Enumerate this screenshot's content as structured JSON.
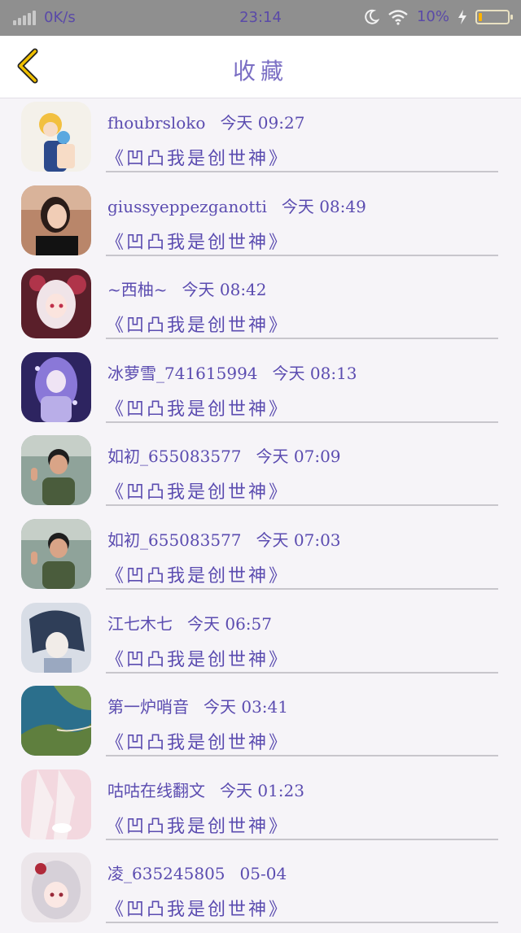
{
  "status_bar": {
    "network_speed": "0K/s",
    "time": "23:14",
    "battery_percent": "10%",
    "battery_level": 0.1,
    "icons": [
      "signal-icon",
      "moon-icon",
      "wifi-icon",
      "charging-icon",
      "battery-icon"
    ]
  },
  "header": {
    "title": "收藏",
    "back_icon": "chevron-left-icon",
    "accent": "#f0c000"
  },
  "items": [
    {
      "user": "fhoubrsloko",
      "time": "今天 09:27",
      "work": "《凹凸我是创世神》"
    },
    {
      "user": "giussyeppezganotti",
      "time": "今天 08:49",
      "work": "《凹凸我是创世神》"
    },
    {
      "user": "~西柚~",
      "time": "今天 08:42",
      "work": "《凹凸我是创世神》"
    },
    {
      "user": "冰萝雪_741615994",
      "time": "今天 08:13",
      "work": "《凹凸我是创世神》"
    },
    {
      "user": "如初_655083577",
      "time": "今天 07:09",
      "work": "《凹凸我是创世神》"
    },
    {
      "user": "如初_655083577",
      "time": "今天 07:03",
      "work": "《凹凸我是创世神》"
    },
    {
      "user": "江七木七",
      "time": "今天 06:57",
      "work": "《凹凸我是创世神》"
    },
    {
      "user": "第一炉哨音",
      "time": "今天 03:41",
      "work": "《凹凸我是创世神》"
    },
    {
      "user": "咕咕在线翻文",
      "time": "今天 01:23",
      "work": "《凹凸我是创世神》"
    },
    {
      "user": "凌_635245805",
      "time": "05-04",
      "work": "《凹凸我是创世神》"
    }
  ],
  "colors": {
    "text": "#5b4cb0",
    "divider": "#c8c6cc",
    "status_bar": "#8f8f8f",
    "background": "#f6f4f8"
  }
}
